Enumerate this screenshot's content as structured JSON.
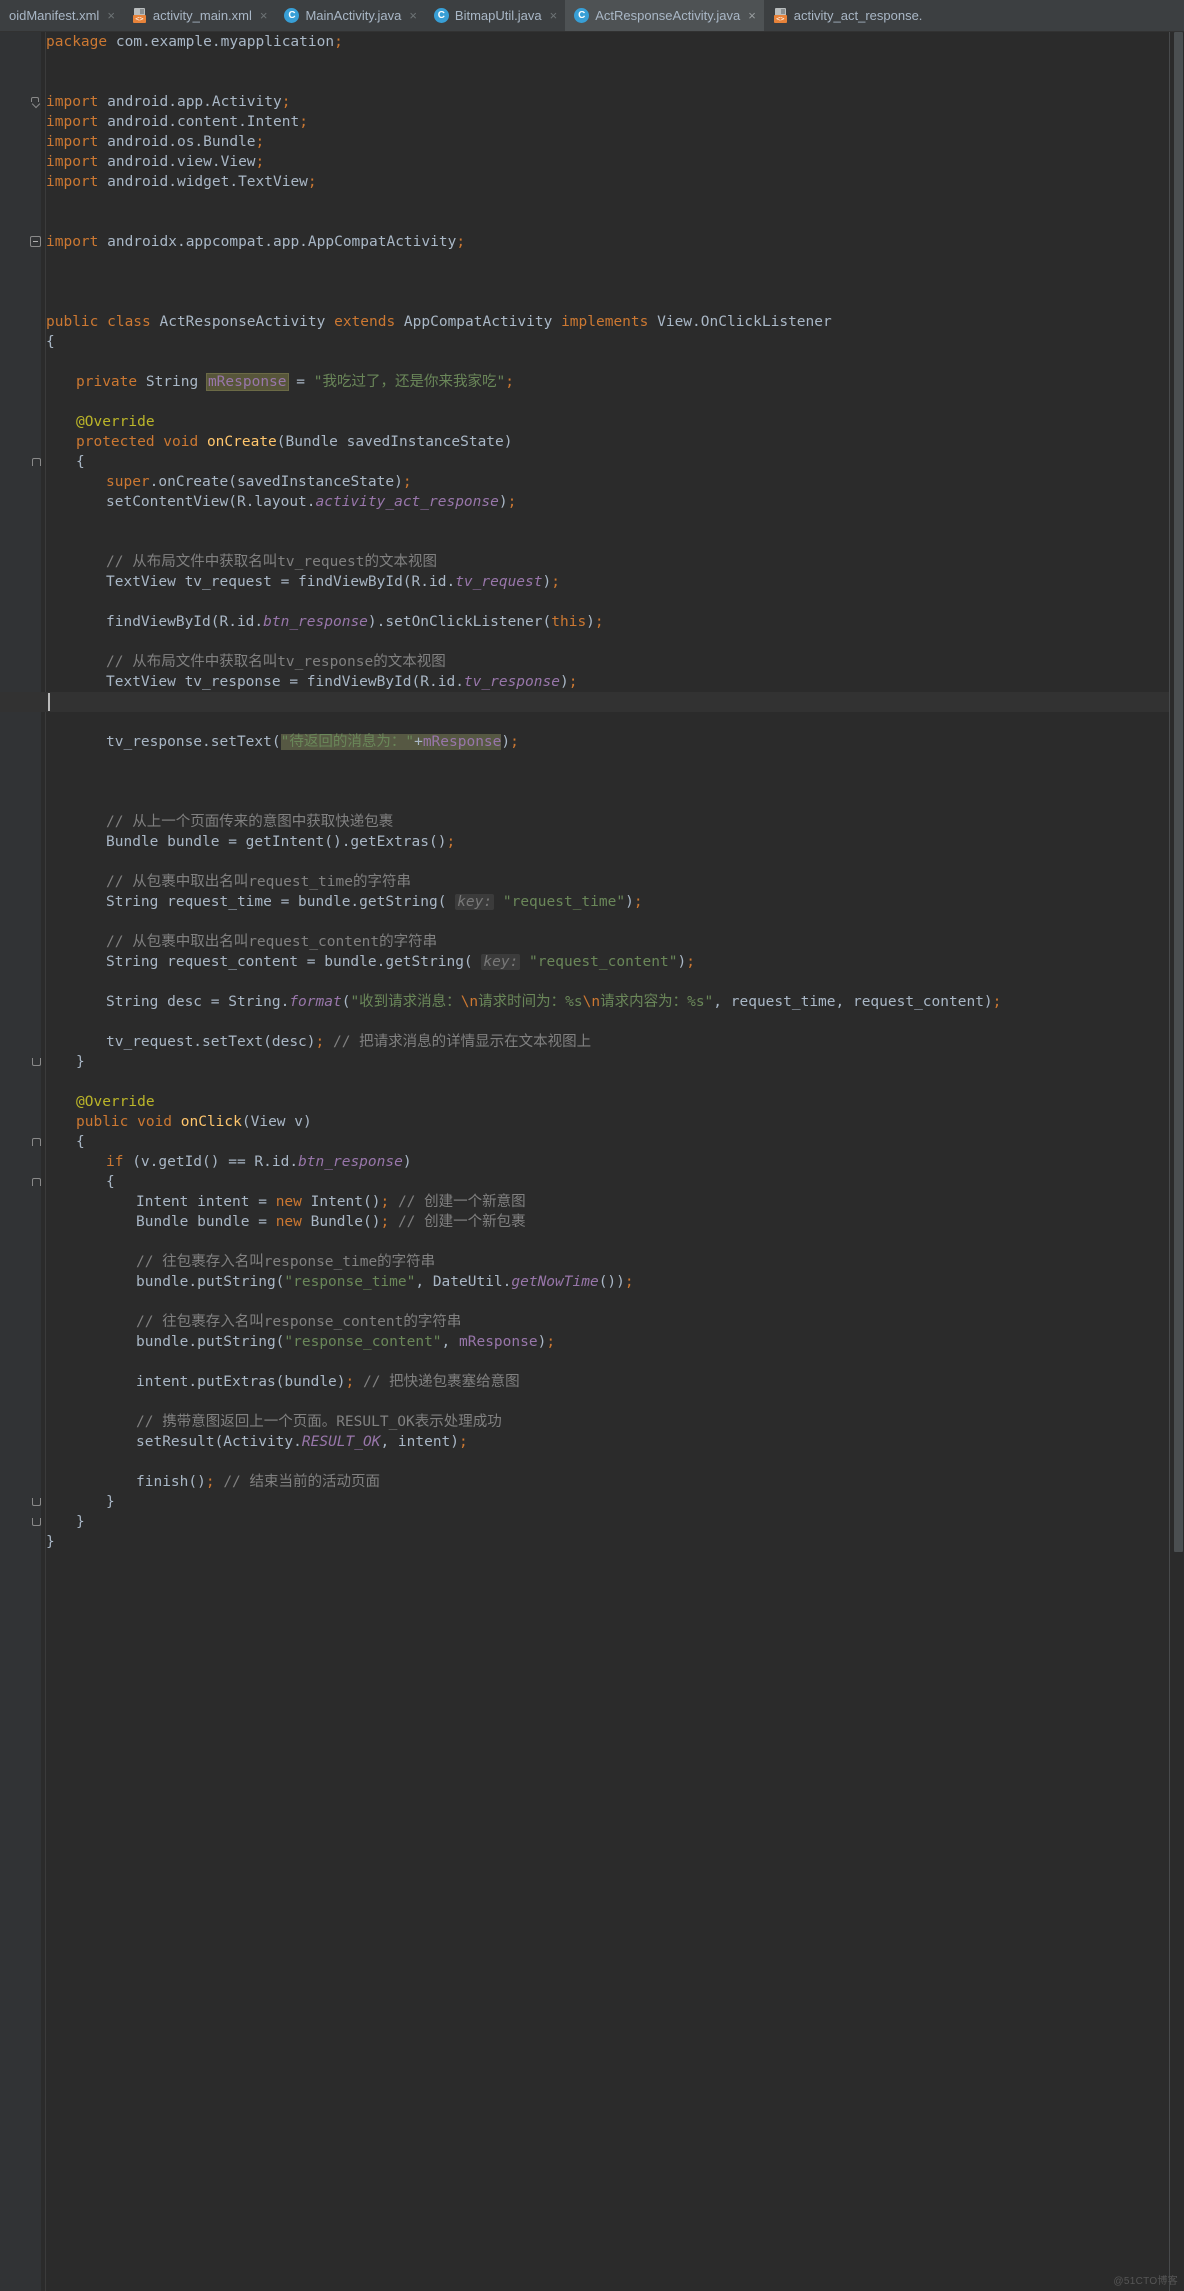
{
  "window": {
    "app": "Android Studio Editor",
    "watermark": "@51CTO博客"
  },
  "tabs": [
    {
      "label": "oidManifest.xml",
      "icon": "xml-file-icon",
      "active": false,
      "close": "×",
      "truncated": true
    },
    {
      "label": "activity_main.xml",
      "icon": "xml-file-icon",
      "active": false,
      "close": "×"
    },
    {
      "label": "MainActivity.java",
      "icon": "java-class-icon",
      "active": false,
      "close": "×"
    },
    {
      "label": "BitmapUtil.java",
      "icon": "java-class-icon",
      "active": false,
      "close": "×"
    },
    {
      "label": "ActResponseActivity.java",
      "icon": "java-class-icon",
      "active": true,
      "close": "×"
    },
    {
      "label": "activity_act_response.",
      "icon": "xml-file-icon",
      "active": false,
      "close": ""
    }
  ],
  "editor": {
    "filename": "ActResponseActivity.java",
    "language": "Java",
    "caret_line": 32,
    "selected_text": "\"待返回的消息为：\"+mResponse",
    "highlighted_identifier": "mResponse",
    "code_lines": [
      {
        "i": 1,
        "t": "package",
        "segs": [
          {
            "c": "kw",
            "s": "package"
          },
          {
            "c": "txt",
            "s": " com.example.myapplication"
          },
          {
            "c": "sem",
            "s": ";"
          }
        ]
      },
      {
        "i": 2,
        "segs": []
      },
      {
        "i": 3,
        "segs": []
      },
      {
        "i": 4,
        "segs": [
          {
            "c": "kw",
            "s": "import"
          },
          {
            "c": "txt",
            "s": " android.app.Activity"
          },
          {
            "c": "sem",
            "s": ";"
          }
        ],
        "fold": "arrow"
      },
      {
        "i": 5,
        "segs": [
          {
            "c": "kw",
            "s": "import"
          },
          {
            "c": "txt",
            "s": " android.content.Intent"
          },
          {
            "c": "sem",
            "s": ";"
          }
        ]
      },
      {
        "i": 6,
        "segs": [
          {
            "c": "kw",
            "s": "import"
          },
          {
            "c": "txt",
            "s": " android.os.Bundle"
          },
          {
            "c": "sem",
            "s": ";"
          }
        ]
      },
      {
        "i": 7,
        "segs": [
          {
            "c": "kw",
            "s": "import"
          },
          {
            "c": "txt",
            "s": " android.view.View"
          },
          {
            "c": "sem",
            "s": ";"
          }
        ]
      },
      {
        "i": 8,
        "segs": [
          {
            "c": "kw",
            "s": "import"
          },
          {
            "c": "txt",
            "s": " android.widget.TextView"
          },
          {
            "c": "sem",
            "s": ";"
          }
        ]
      },
      {
        "i": 9,
        "segs": []
      },
      {
        "i": 10,
        "segs": []
      },
      {
        "i": 11,
        "segs": [
          {
            "c": "kw",
            "s": "import"
          },
          {
            "c": "txt",
            "s": " androidx.appcompat.app.AppCompatActivity"
          },
          {
            "c": "sem",
            "s": ";"
          }
        ],
        "fold": "minus"
      },
      {
        "i": 12,
        "segs": []
      },
      {
        "i": 13,
        "segs": []
      },
      {
        "i": 14,
        "segs": []
      },
      {
        "i": 15,
        "segs": [
          {
            "c": "kw",
            "s": "public class"
          },
          {
            "c": "txt",
            "s": " ActResponseActivity "
          },
          {
            "c": "kw",
            "s": "extends"
          },
          {
            "c": "txt",
            "s": " AppCompatActivity "
          },
          {
            "c": "kw",
            "s": "implements"
          },
          {
            "c": "txt",
            "s": " View.OnClickListener"
          }
        ]
      },
      {
        "i": 16,
        "segs": [
          {
            "c": "txt",
            "s": "{"
          }
        ]
      },
      {
        "i": 17,
        "segs": []
      },
      {
        "i": 18,
        "indent": 1,
        "segs": [
          {
            "c": "kw",
            "s": "private"
          },
          {
            "c": "txt",
            "s": " String "
          },
          {
            "c": "idhl fld",
            "s": "mResponse"
          },
          {
            "c": "txt",
            "s": " = "
          },
          {
            "c": "str",
            "s": "\"我吃过了，还是你来我家吃\""
          },
          {
            "c": "sem",
            "s": ";"
          }
        ]
      },
      {
        "i": 19,
        "segs": []
      },
      {
        "i": 20,
        "indent": 1,
        "segs": [
          {
            "c": "ann",
            "s": "@Override"
          }
        ]
      },
      {
        "i": 21,
        "indent": 1,
        "segs": [
          {
            "c": "kw",
            "s": "protected void"
          },
          {
            "c": "txt",
            "s": " "
          },
          {
            "c": "fn",
            "s": "onCreate"
          },
          {
            "c": "txt",
            "s": "(Bundle savedInstanceState)"
          }
        ]
      },
      {
        "i": 22,
        "indent": 1,
        "segs": [
          {
            "c": "txt",
            "s": "{"
          }
        ],
        "fold": "brace-open"
      },
      {
        "i": 23,
        "indent": 2,
        "segs": [
          {
            "c": "kw",
            "s": "super"
          },
          {
            "c": "txt",
            "s": ".onCreate(savedInstanceState)"
          },
          {
            "c": "sem",
            "s": ";"
          }
        ]
      },
      {
        "i": 24,
        "indent": 2,
        "segs": [
          {
            "c": "txt",
            "s": "setContentView(R.layout."
          },
          {
            "c": "stat",
            "s": "activity_act_response"
          },
          {
            "c": "txt",
            "s": ")"
          },
          {
            "c": "sem",
            "s": ";"
          }
        ]
      },
      {
        "i": 25,
        "segs": []
      },
      {
        "i": 26,
        "segs": []
      },
      {
        "i": 27,
        "indent": 2,
        "segs": [
          {
            "c": "cmt",
            "s": "// 从布局文件中获取名叫tv_request的文本视图"
          }
        ]
      },
      {
        "i": 28,
        "indent": 2,
        "segs": [
          {
            "c": "txt",
            "s": "TextView tv_request = findViewById(R.id."
          },
          {
            "c": "stat",
            "s": "tv_request"
          },
          {
            "c": "txt",
            "s": ")"
          },
          {
            "c": "sem",
            "s": ";"
          }
        ]
      },
      {
        "i": 29,
        "segs": []
      },
      {
        "i": 30,
        "indent": 2,
        "segs": [
          {
            "c": "txt",
            "s": "findViewById(R.id."
          },
          {
            "c": "stat",
            "s": "btn_response"
          },
          {
            "c": "txt",
            "s": ")."
          },
          {
            "c": "txt",
            "s": "setOnClickListener("
          },
          {
            "c": "kw",
            "s": "this"
          },
          {
            "c": "txt",
            "s": ")"
          },
          {
            "c": "sem",
            "s": ";"
          }
        ]
      },
      {
        "i": 31,
        "segs": []
      },
      {
        "i": 32,
        "indent": 2,
        "segs": [
          {
            "c": "cmt",
            "s": "// 从布局文件中获取名叫tv_response的文本视图"
          }
        ]
      },
      {
        "i": 33,
        "indent": 2,
        "segs": [
          {
            "c": "txt",
            "s": "TextView tv_response = findViewById(R.id."
          },
          {
            "c": "stat",
            "s": "tv_response"
          },
          {
            "c": "txt",
            "s": ")"
          },
          {
            "c": "sem",
            "s": ";"
          }
        ]
      },
      {
        "i": 34,
        "segs": [],
        "caret": true
      },
      {
        "i": 35,
        "segs": []
      },
      {
        "i": 36,
        "indent": 2,
        "segs": [
          {
            "c": "txt",
            "s": "tv_response.setText("
          },
          {
            "c": "sel str",
            "s": "\"待返回的消息为：\""
          },
          {
            "c": "sel txt",
            "s": "+"
          },
          {
            "c": "sel fld",
            "s": "mResponse"
          },
          {
            "c": "txt",
            "s": ")"
          },
          {
            "c": "sem",
            "s": ";"
          }
        ]
      },
      {
        "i": 37,
        "segs": []
      },
      {
        "i": 38,
        "segs": []
      },
      {
        "i": 39,
        "segs": []
      },
      {
        "i": 40,
        "indent": 2,
        "segs": [
          {
            "c": "cmt",
            "s": "// 从上一个页面传来的意图中获取快递包裹"
          }
        ]
      },
      {
        "i": 41,
        "indent": 2,
        "segs": [
          {
            "c": "txt",
            "s": "Bundle bundle = getIntent().getExtras()"
          },
          {
            "c": "sem",
            "s": ";"
          }
        ]
      },
      {
        "i": 42,
        "segs": []
      },
      {
        "i": 43,
        "indent": 2,
        "segs": [
          {
            "c": "cmt",
            "s": "// 从包裹中取出名叫request_time的字符串"
          }
        ]
      },
      {
        "i": 44,
        "indent": 2,
        "segs": [
          {
            "c": "txt",
            "s": "String request_time = bundle.getString( "
          },
          {
            "c": "hintbg",
            "s": "key:"
          },
          {
            "c": "txt",
            "s": " "
          },
          {
            "c": "str",
            "s": "\"request_time\""
          },
          {
            "c": "txt",
            "s": ")"
          },
          {
            "c": "sem",
            "s": ";"
          }
        ]
      },
      {
        "i": 45,
        "segs": []
      },
      {
        "i": 46,
        "indent": 2,
        "segs": [
          {
            "c": "cmt",
            "s": "// 从包裹中取出名叫request_content的字符串"
          }
        ]
      },
      {
        "i": 47,
        "indent": 2,
        "segs": [
          {
            "c": "txt",
            "s": "String request_content = bundle.getString( "
          },
          {
            "c": "hintbg",
            "s": "key:"
          },
          {
            "c": "txt",
            "s": " "
          },
          {
            "c": "str",
            "s": "\"request_content\""
          },
          {
            "c": "txt",
            "s": ")"
          },
          {
            "c": "sem",
            "s": ";"
          }
        ]
      },
      {
        "i": 48,
        "segs": []
      },
      {
        "i": 49,
        "indent": 2,
        "segs": [
          {
            "c": "txt",
            "s": "String desc = String."
          },
          {
            "c": "stat",
            "s": "format"
          },
          {
            "c": "txt",
            "s": "("
          },
          {
            "c": "str",
            "s": "\"收到请求消息："
          },
          {
            "c": "esc",
            "s": "\\n"
          },
          {
            "c": "str",
            "s": "请求时间为：%s"
          },
          {
            "c": "esc",
            "s": "\\n"
          },
          {
            "c": "str",
            "s": "请求内容为：%s\""
          },
          {
            "c": "txt",
            "s": ", request_time, request_content)"
          },
          {
            "c": "sem",
            "s": ";"
          }
        ]
      },
      {
        "i": 50,
        "segs": []
      },
      {
        "i": 51,
        "indent": 2,
        "segs": [
          {
            "c": "txt",
            "s": "tv_request.setText(desc)"
          },
          {
            "c": "sem",
            "s": ";"
          },
          {
            "c": "txt",
            "s": " "
          },
          {
            "c": "cmt",
            "s": "// 把请求消息的详情显示在文本视图上"
          }
        ]
      },
      {
        "i": 52,
        "indent": 1,
        "segs": [
          {
            "c": "txt",
            "s": "}"
          }
        ],
        "fold": "brace-close"
      },
      {
        "i": 53,
        "segs": []
      },
      {
        "i": 54,
        "indent": 1,
        "segs": [
          {
            "c": "ann",
            "s": "@Override"
          }
        ]
      },
      {
        "i": 55,
        "indent": 1,
        "segs": [
          {
            "c": "kw",
            "s": "public void"
          },
          {
            "c": "txt",
            "s": " "
          },
          {
            "c": "fn",
            "s": "onClick"
          },
          {
            "c": "txt",
            "s": "(View v)"
          }
        ]
      },
      {
        "i": 56,
        "indent": 1,
        "segs": [
          {
            "c": "txt",
            "s": "{"
          }
        ],
        "fold": "brace-open"
      },
      {
        "i": 57,
        "indent": 2,
        "segs": [
          {
            "c": "kw",
            "s": "if"
          },
          {
            "c": "txt",
            "s": " (v.getId() == R.id."
          },
          {
            "c": "stat",
            "s": "btn_response"
          },
          {
            "c": "txt",
            "s": ")"
          }
        ]
      },
      {
        "i": 58,
        "indent": 2,
        "segs": [
          {
            "c": "txt",
            "s": "{"
          }
        ],
        "fold": "brace-open"
      },
      {
        "i": 59,
        "indent": 3,
        "segs": [
          {
            "c": "txt",
            "s": "Intent intent = "
          },
          {
            "c": "kw",
            "s": "new"
          },
          {
            "c": "txt",
            "s": " Intent()"
          },
          {
            "c": "sem",
            "s": ";"
          },
          {
            "c": "txt",
            "s": " "
          },
          {
            "c": "cmt",
            "s": "// 创建一个新意图"
          }
        ]
      },
      {
        "i": 60,
        "indent": 3,
        "segs": [
          {
            "c": "txt",
            "s": "Bundle bundle = "
          },
          {
            "c": "kw",
            "s": "new"
          },
          {
            "c": "txt",
            "s": " Bundle()"
          },
          {
            "c": "sem",
            "s": ";"
          },
          {
            "c": "txt",
            "s": " "
          },
          {
            "c": "cmt",
            "s": "// 创建一个新包裹"
          }
        ]
      },
      {
        "i": 61,
        "segs": []
      },
      {
        "i": 62,
        "indent": 3,
        "segs": [
          {
            "c": "cmt",
            "s": "// 往包裹存入名叫response_time的字符串"
          }
        ]
      },
      {
        "i": 63,
        "indent": 3,
        "segs": [
          {
            "c": "txt",
            "s": "bundle.putString("
          },
          {
            "c": "str",
            "s": "\"response_time\""
          },
          {
            "c": "txt",
            "s": ", DateUtil."
          },
          {
            "c": "stat",
            "s": "getNowTime"
          },
          {
            "c": "txt",
            "s": "())"
          },
          {
            "c": "sem",
            "s": ";"
          }
        ]
      },
      {
        "i": 64,
        "segs": []
      },
      {
        "i": 65,
        "indent": 3,
        "segs": [
          {
            "c": "cmt",
            "s": "// 往包裹存入名叫response_content的字符串"
          }
        ]
      },
      {
        "i": 66,
        "indent": 3,
        "segs": [
          {
            "c": "txt",
            "s": "bundle.putString("
          },
          {
            "c": "str",
            "s": "\"response_content\""
          },
          {
            "c": "txt",
            "s": ", "
          },
          {
            "c": "fld",
            "s": "mResponse"
          },
          {
            "c": "txt",
            "s": ")"
          },
          {
            "c": "sem",
            "s": ";"
          }
        ]
      },
      {
        "i": 67,
        "segs": []
      },
      {
        "i": 68,
        "indent": 3,
        "segs": [
          {
            "c": "txt",
            "s": "intent.putExtras(bundle)"
          },
          {
            "c": "sem",
            "s": ";"
          },
          {
            "c": "txt",
            "s": " "
          },
          {
            "c": "cmt",
            "s": "// 把快递包裹塞给意图"
          }
        ]
      },
      {
        "i": 69,
        "segs": []
      },
      {
        "i": 70,
        "indent": 3,
        "segs": [
          {
            "c": "cmt",
            "s": "// 携带意图返回上一个页面。RESULT_OK表示处理成功"
          }
        ]
      },
      {
        "i": 71,
        "indent": 3,
        "segs": [
          {
            "c": "txt",
            "s": "setResult(Activity."
          },
          {
            "c": "stat",
            "s": "RESULT_OK"
          },
          {
            "c": "txt",
            "s": ", intent)"
          },
          {
            "c": "sem",
            "s": ";"
          }
        ]
      },
      {
        "i": 72,
        "segs": []
      },
      {
        "i": 73,
        "indent": 3,
        "segs": [
          {
            "c": "txt",
            "s": "finish()"
          },
          {
            "c": "sem",
            "s": ";"
          },
          {
            "c": "txt",
            "s": " "
          },
          {
            "c": "cmt",
            "s": "// 结束当前的活动页面"
          }
        ]
      },
      {
        "i": 74,
        "indent": 2,
        "segs": [
          {
            "c": "txt",
            "s": "}"
          }
        ],
        "fold": "brace-close"
      },
      {
        "i": 75,
        "indent": 1,
        "segs": [
          {
            "c": "txt",
            "s": "}"
          }
        ],
        "fold": "brace-close"
      },
      {
        "i": 76,
        "segs": [
          {
            "c": "txt",
            "s": "}"
          }
        ]
      }
    ]
  },
  "colors": {
    "background": "#2b2b2b",
    "gutter": "#313335",
    "tabbar": "#3c3f41",
    "tab_active": "#4e5254",
    "keyword": "#cc7832",
    "string": "#6a8759",
    "comment": "#808080",
    "field": "#9876aa",
    "method": "#ffc66d",
    "annotation": "#bbb529",
    "default_text": "#a9b7c6",
    "selection": "#565843",
    "identifier_highlight": "#57553a",
    "scrollbar_thumb": "#4b4f51"
  }
}
